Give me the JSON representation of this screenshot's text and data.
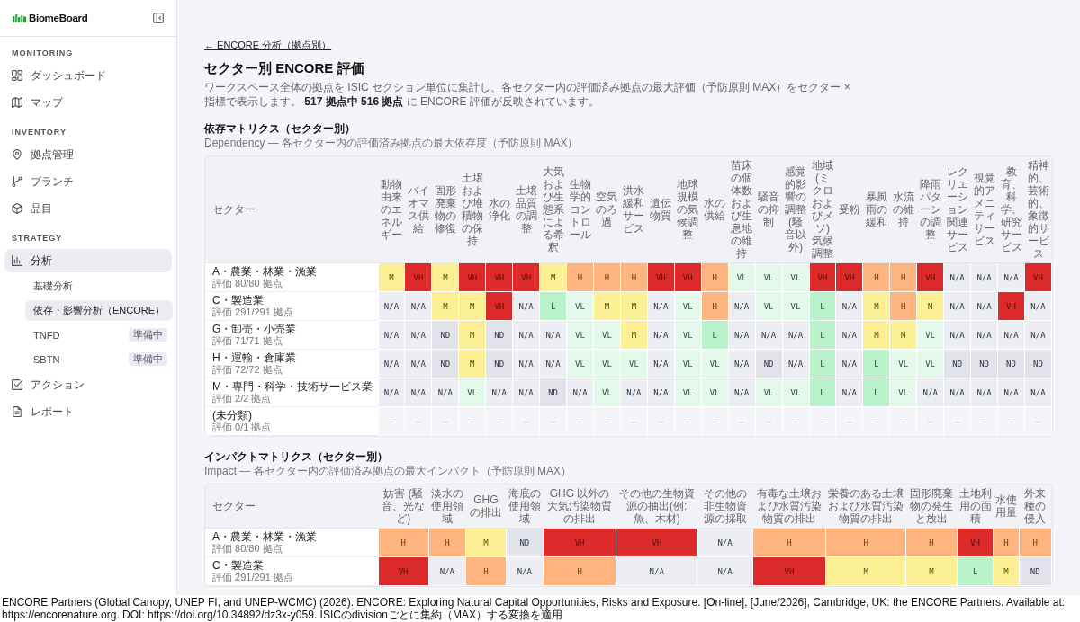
{
  "sidebar": {
    "logo": "BiomeBoard",
    "sections": [
      {
        "title": "MONITORING",
        "items": [
          {
            "label": "ダッシュボード",
            "selected": false
          },
          {
            "label": "マップ",
            "selected": false
          }
        ]
      },
      {
        "title": "INVENTORY",
        "items": [
          {
            "label": "拠点管理",
            "selected": false
          },
          {
            "label": "ブランチ",
            "selected": false
          },
          {
            "label": "品目",
            "selected": false
          }
        ]
      },
      {
        "title": "STRATEGY",
        "items": [
          {
            "label": "分析",
            "selected": true,
            "children": [
              {
                "label": "基礎分析",
                "selected": false
              },
              {
                "label": "依存・影響分析（ENCORE）",
                "selected": true
              },
              {
                "label": "TNFD",
                "selected": false,
                "badge": "準備中"
              },
              {
                "label": "SBTN",
                "selected": false,
                "badge": "準備中"
              }
            ]
          },
          {
            "label": "アクション",
            "selected": false
          },
          {
            "label": "レポート",
            "selected": false
          }
        ]
      }
    ]
  },
  "page": {
    "back_link": "← ENCORE 分析（拠点別）",
    "title": "セクター別 ENCORE 評価",
    "description": "ワークスペース全体の拠点を ISIC セクション単位に集計し、各セクター内の評価済み拠点の最大評価（予防原則 MAX）をセクター × 指標で表示します。 **517 拠点中 516 拠点** に ENCORE 評価が反映されています。"
  },
  "dependency_matrix": {
    "title": "依存マトリクス（セクター別）",
    "subtitle": "Dependency — 各セクター内の評価済み拠点の最大依存度（予防原則 MAX）",
    "sector_column": "セクター",
    "columns": [
      "動物由来のエネルギー",
      "バイオマス供給",
      "固形廃棄物の修復",
      "土壌および堆積物の保持",
      "水の浄化",
      "土壌品質の調整",
      "大気および生態系による希釈",
      "生物学的コントロール",
      "空気のろ過",
      "洪水緩和サービス",
      "遺伝物質",
      "地球規模の気候調整",
      "水の供給",
      "苗床の個体数および生息地の維持",
      "騒音の抑制",
      "感覚的影響の調整(騒音以外)",
      "地域(ミクロおよびメソ)気候調整",
      "受粉",
      "暴風雨の緩和",
      "水流の維持",
      "降雨パターンの調整",
      "レクリエーション関連サービス",
      "視覚的アメニティサービス",
      "教育、科学、研究サービス",
      "精神的、芸術的、象徴的サービス"
    ],
    "rows": [
      {
        "sector": "A・農業・林業・漁業",
        "count": "評価 80/80 拠点",
        "cells": [
          {
            "rating": "M",
            "kind": "medium"
          },
          {
            "rating": "VH",
            "kind": "very_high"
          },
          {
            "rating": "M",
            "kind": "medium"
          },
          {
            "rating": "VH",
            "kind": "very_high"
          },
          {
            "rating": "VH",
            "kind": "very_high"
          },
          {
            "rating": "VH",
            "kind": "very_high"
          },
          {
            "rating": "M",
            "kind": "medium"
          },
          {
            "rating": "H",
            "kind": "high"
          },
          {
            "rating": "H",
            "kind": "high"
          },
          {
            "rating": "H",
            "kind": "high"
          },
          {
            "rating": "VH",
            "kind": "very_high"
          },
          {
            "rating": "VH",
            "kind": "very_high"
          },
          {
            "rating": "H",
            "kind": "high"
          },
          {
            "rating": "VL",
            "kind": "very_low"
          },
          {
            "rating": "VL",
            "kind": "very_low"
          },
          {
            "rating": "VL",
            "kind": "very_low"
          },
          {
            "rating": "VH",
            "kind": "very_high"
          },
          {
            "rating": "VH",
            "kind": "very_high"
          },
          {
            "rating": "H",
            "kind": "high"
          },
          {
            "rating": "H",
            "kind": "high"
          },
          {
            "rating": "VH",
            "kind": "very_high"
          },
          {
            "rating": "N/A",
            "kind": "not_applicable"
          },
          {
            "rating": "N/A",
            "kind": "not_applicable"
          },
          {
            "rating": "N/A",
            "kind": "not_applicable"
          },
          {
            "rating": "VH",
            "kind": "very_high"
          }
        ]
      },
      {
        "sector": "C・製造業",
        "count": "評価 291/291 拠点",
        "cells": [
          {
            "rating": "N/A",
            "kind": "not_applicable"
          },
          {
            "rating": "N/A",
            "kind": "not_applicable"
          },
          {
            "rating": "M",
            "kind": "medium"
          },
          {
            "rating": "M",
            "kind": "medium"
          },
          {
            "rating": "VH",
            "kind": "very_high"
          },
          {
            "rating": "N/A",
            "kind": "not_applicable"
          },
          {
            "rating": "L",
            "kind": "low"
          },
          {
            "rating": "VL",
            "kind": "very_low"
          },
          {
            "rating": "M",
            "kind": "medium"
          },
          {
            "rating": "M",
            "kind": "medium"
          },
          {
            "rating": "N/A",
            "kind": "not_applicable"
          },
          {
            "rating": "VL",
            "kind": "very_low"
          },
          {
            "rating": "H",
            "kind": "high"
          },
          {
            "rating": "N/A",
            "kind": "not_applicable"
          },
          {
            "rating": "VL",
            "kind": "very_low"
          },
          {
            "rating": "VL",
            "kind": "very_low"
          },
          {
            "rating": "L",
            "kind": "low"
          },
          {
            "rating": "N/A",
            "kind": "not_applicable"
          },
          {
            "rating": "M",
            "kind": "medium"
          },
          {
            "rating": "H",
            "kind": "high"
          },
          {
            "rating": "M",
            "kind": "medium"
          },
          {
            "rating": "N/A",
            "kind": "not_applicable"
          },
          {
            "rating": "N/A",
            "kind": "not_applicable"
          },
          {
            "rating": "VH",
            "kind": "very_high"
          },
          {
            "rating": "N/A",
            "kind": "not_applicable"
          }
        ]
      },
      {
        "sector": "G・卸売・小売業",
        "count": "評価 71/71 拠点",
        "cells": [
          {
            "rating": "N/A",
            "kind": "not_applicable"
          },
          {
            "rating": "N/A",
            "kind": "not_applicable"
          },
          {
            "rating": "ND",
            "kind": "no_data"
          },
          {
            "rating": "M",
            "kind": "medium"
          },
          {
            "rating": "ND",
            "kind": "no_data"
          },
          {
            "rating": "N/A",
            "kind": "not_applicable"
          },
          {
            "rating": "N/A",
            "kind": "not_applicable"
          },
          {
            "rating": "VL",
            "kind": "very_low"
          },
          {
            "rating": "VL",
            "kind": "very_low"
          },
          {
            "rating": "M",
            "kind": "medium"
          },
          {
            "rating": "N/A",
            "kind": "not_applicable"
          },
          {
            "rating": "VL",
            "kind": "very_low"
          },
          {
            "rating": "L",
            "kind": "low"
          },
          {
            "rating": "N/A",
            "kind": "not_applicable"
          },
          {
            "rating": "N/A",
            "kind": "not_applicable"
          },
          {
            "rating": "N/A",
            "kind": "not_applicable"
          },
          {
            "rating": "L",
            "kind": "low"
          },
          {
            "rating": "N/A",
            "kind": "not_applicable"
          },
          {
            "rating": "M",
            "kind": "medium"
          },
          {
            "rating": "M",
            "kind": "medium"
          },
          {
            "rating": "VL",
            "kind": "very_low"
          },
          {
            "rating": "N/A",
            "kind": "not_applicable"
          },
          {
            "rating": "N/A",
            "kind": "not_applicable"
          },
          {
            "rating": "N/A",
            "kind": "not_applicable"
          },
          {
            "rating": "N/A",
            "kind": "not_applicable"
          }
        ]
      },
      {
        "sector": "H・運輸・倉庫業",
        "count": "評価 72/72 拠点",
        "cells": [
          {
            "rating": "N/A",
            "kind": "not_applicable"
          },
          {
            "rating": "N/A",
            "kind": "not_applicable"
          },
          {
            "rating": "ND",
            "kind": "no_data"
          },
          {
            "rating": "M",
            "kind": "medium"
          },
          {
            "rating": "ND",
            "kind": "no_data"
          },
          {
            "rating": "N/A",
            "kind": "not_applicable"
          },
          {
            "rating": "N/A",
            "kind": "not_applicable"
          },
          {
            "rating": "VL",
            "kind": "very_low"
          },
          {
            "rating": "VL",
            "kind": "very_low"
          },
          {
            "rating": "VL",
            "kind": "very_low"
          },
          {
            "rating": "N/A",
            "kind": "not_applicable"
          },
          {
            "rating": "VL",
            "kind": "very_low"
          },
          {
            "rating": "VL",
            "kind": "very_low"
          },
          {
            "rating": "N/A",
            "kind": "not_applicable"
          },
          {
            "rating": "ND",
            "kind": "no_data"
          },
          {
            "rating": "N/A",
            "kind": "not_applicable"
          },
          {
            "rating": "L",
            "kind": "low"
          },
          {
            "rating": "N/A",
            "kind": "not_applicable"
          },
          {
            "rating": "L",
            "kind": "low"
          },
          {
            "rating": "VL",
            "kind": "very_low"
          },
          {
            "rating": "VL",
            "kind": "very_low"
          },
          {
            "rating": "ND",
            "kind": "no_data"
          },
          {
            "rating": "ND",
            "kind": "no_data"
          },
          {
            "rating": "ND",
            "kind": "no_data"
          },
          {
            "rating": "ND",
            "kind": "no_data"
          }
        ]
      },
      {
        "sector": "M・専門・科学・技術サービス業",
        "count": "評価 2/2 拠点",
        "cells": [
          {
            "rating": "N/A",
            "kind": "not_applicable"
          },
          {
            "rating": "N/A",
            "kind": "not_applicable"
          },
          {
            "rating": "N/A",
            "kind": "not_applicable"
          },
          {
            "rating": "VL",
            "kind": "very_low"
          },
          {
            "rating": "N/A",
            "kind": "not_applicable"
          },
          {
            "rating": "N/A",
            "kind": "not_applicable"
          },
          {
            "rating": "ND",
            "kind": "no_data"
          },
          {
            "rating": "N/A",
            "kind": "not_applicable"
          },
          {
            "rating": "VL",
            "kind": "very_low"
          },
          {
            "rating": "N/A",
            "kind": "not_applicable"
          },
          {
            "rating": "N/A",
            "kind": "not_applicable"
          },
          {
            "rating": "VL",
            "kind": "very_low"
          },
          {
            "rating": "VL",
            "kind": "very_low"
          },
          {
            "rating": "N/A",
            "kind": "not_applicable"
          },
          {
            "rating": "VL",
            "kind": "very_low"
          },
          {
            "rating": "VL",
            "kind": "very_low"
          },
          {
            "rating": "L",
            "kind": "low"
          },
          {
            "rating": "N/A",
            "kind": "not_applicable"
          },
          {
            "rating": "L",
            "kind": "low"
          },
          {
            "rating": "VL",
            "kind": "very_low"
          },
          {
            "rating": "N/A",
            "kind": "not_applicable"
          },
          {
            "rating": "N/A",
            "kind": "not_applicable"
          },
          {
            "rating": "N/A",
            "kind": "not_applicable"
          },
          {
            "rating": "N/A",
            "kind": "not_applicable"
          },
          {
            "rating": "N/A",
            "kind": "not_applicable"
          }
        ]
      },
      {
        "sector": "(未分類)",
        "count": "評価 0/1 拠点",
        "cells": [
          {
            "rating": "—",
            "kind": "unrated"
          },
          {
            "rating": "—",
            "kind": "unrated"
          },
          {
            "rating": "—",
            "kind": "unrated"
          },
          {
            "rating": "—",
            "kind": "unrated"
          },
          {
            "rating": "—",
            "kind": "unrated"
          },
          {
            "rating": "—",
            "kind": "unrated"
          },
          {
            "rating": "—",
            "kind": "unrated"
          },
          {
            "rating": "—",
            "kind": "unrated"
          },
          {
            "rating": "—",
            "kind": "unrated"
          },
          {
            "rating": "—",
            "kind": "unrated"
          },
          {
            "rating": "—",
            "kind": "unrated"
          },
          {
            "rating": "—",
            "kind": "unrated"
          },
          {
            "rating": "—",
            "kind": "unrated"
          },
          {
            "rating": "—",
            "kind": "unrated"
          },
          {
            "rating": "—",
            "kind": "unrated"
          },
          {
            "rating": "—",
            "kind": "unrated"
          },
          {
            "rating": "—",
            "kind": "unrated"
          },
          {
            "rating": "—",
            "kind": "unrated"
          },
          {
            "rating": "—",
            "kind": "unrated"
          },
          {
            "rating": "—",
            "kind": "unrated"
          },
          {
            "rating": "—",
            "kind": "unrated"
          },
          {
            "rating": "—",
            "kind": "unrated"
          },
          {
            "rating": "—",
            "kind": "unrated"
          },
          {
            "rating": "—",
            "kind": "unrated"
          },
          {
            "rating": "—",
            "kind": "unrated"
          }
        ]
      }
    ]
  },
  "impact_matrix": {
    "title": "インパクトマトリクス（セクター別）",
    "subtitle": "Impact — 各セクター内の評価済み拠点の最大インパクト（予防原則 MAX）",
    "sector_column": "セクター",
    "columns": [
      "妨害 (騒音、光など)",
      "淡水の使用領域",
      "GHG の排出",
      "海底の使用領域",
      "GHG 以外の大気汚染物質の排出",
      "その他の生物資源の抽出(例: 魚、木材)",
      "その他の非生物資源の採取",
      "有毒な土壌および水質汚染物質の排出",
      "栄養のある土壌および水質汚染物質の排出",
      "固形廃棄物の発生と放出",
      "土地利用の面積",
      "水使用量",
      "外来種の侵入"
    ],
    "rows": [
      {
        "sector": "A・農業・林業・漁業",
        "count": "評価 80/80 拠点",
        "cells": [
          {
            "rating": "H",
            "kind": "high"
          },
          {
            "rating": "H",
            "kind": "high"
          },
          {
            "rating": "M",
            "kind": "medium"
          },
          {
            "rating": "ND",
            "kind": "no_data"
          },
          {
            "rating": "VH",
            "kind": "very_high"
          },
          {
            "rating": "VH",
            "kind": "very_high"
          },
          {
            "rating": "N/A",
            "kind": "not_applicable"
          },
          {
            "rating": "H",
            "kind": "high"
          },
          {
            "rating": "H",
            "kind": "high"
          },
          {
            "rating": "H",
            "kind": "high"
          },
          {
            "rating": "VH",
            "kind": "very_high"
          },
          {
            "rating": "H",
            "kind": "high"
          },
          {
            "rating": "H",
            "kind": "high"
          }
        ]
      },
      {
        "sector": "C・製造業",
        "count": "評価 291/291 拠点",
        "cells": [
          {
            "rating": "VH",
            "kind": "very_high"
          },
          {
            "rating": "N/A",
            "kind": "not_applicable"
          },
          {
            "rating": "H",
            "kind": "high"
          },
          {
            "rating": "N/A",
            "kind": "not_applicable"
          },
          {
            "rating": "H",
            "kind": "high"
          },
          {
            "rating": "N/A",
            "kind": "not_applicable"
          },
          {
            "rating": "N/A",
            "kind": "not_applicable"
          },
          {
            "rating": "VH",
            "kind": "very_high"
          },
          {
            "rating": "M",
            "kind": "medium"
          },
          {
            "rating": "M",
            "kind": "medium"
          },
          {
            "rating": "L",
            "kind": "low"
          },
          {
            "rating": "M",
            "kind": "medium"
          },
          {
            "rating": "ND",
            "kind": "no_data"
          }
        ]
      }
    ]
  },
  "footer": "ENCORE Partners (Global Canopy, UNEP FI, and UNEP-WCMC) (2026). ENCORE: Exploring Natural Capital Opportunities, Risks and Exposure. [On-line], [June/2026], Cambridge, UK: the ENCORE Partners. Available at: https://encorenature.org. DOI: https://doi.org/10.34892/dz3x-y059. ISICのdivisionごとに集約（MAX）する変換を適用"
}
